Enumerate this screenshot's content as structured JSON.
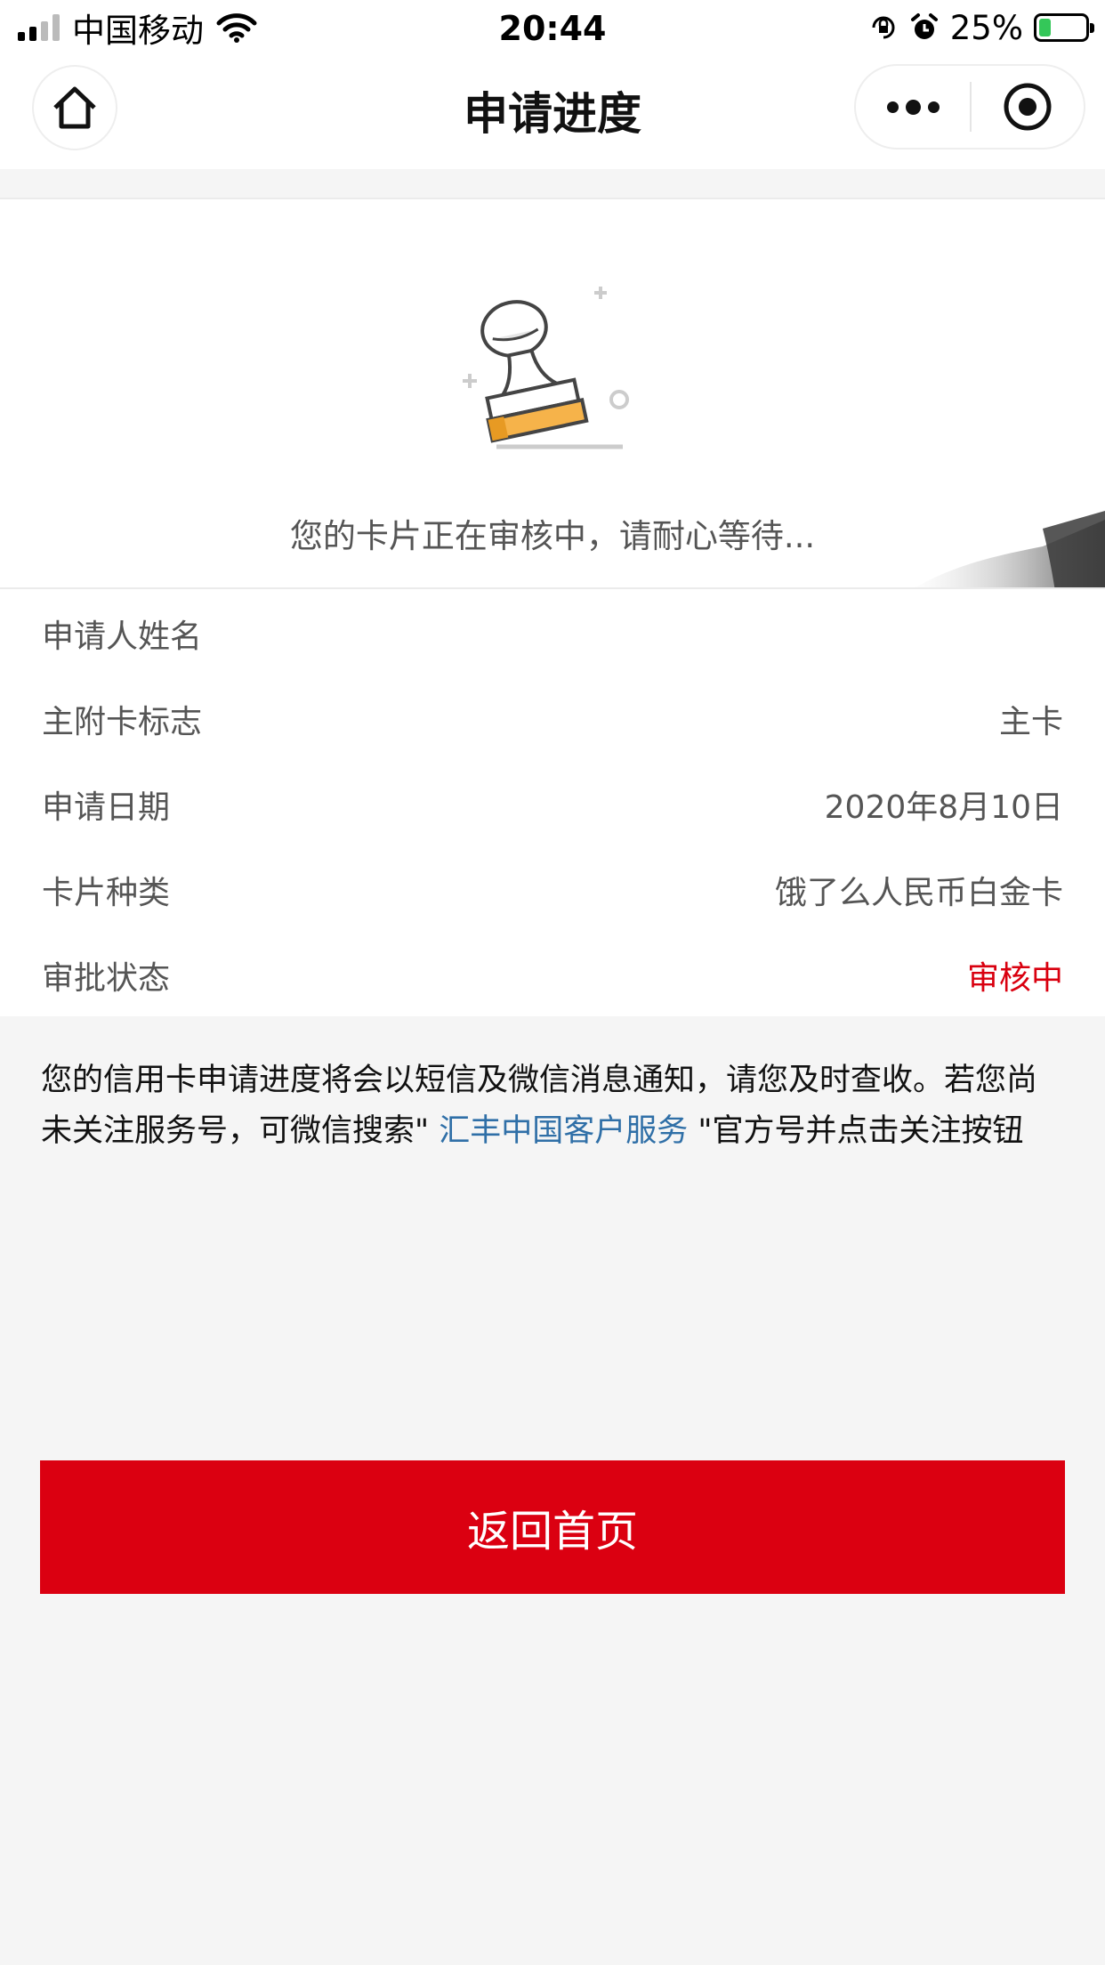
{
  "status_bar": {
    "carrier": "中国移动",
    "time": "20:44",
    "battery": "25%"
  },
  "nav": {
    "title": "申请进度"
  },
  "status_card": {
    "message": "您的卡片正在审核中，请耐心等待..."
  },
  "details": [
    {
      "label": "申请人姓名",
      "value": ""
    },
    {
      "label": "主附卡标志",
      "value": "主卡"
    },
    {
      "label": "申请日期",
      "value": "2020年8月10日"
    },
    {
      "label": "卡片种类",
      "value": "饿了么人民币白金卡"
    },
    {
      "label": "审批状态",
      "value": "审核中"
    }
  ],
  "note": {
    "before": "您的信用卡申请进度将会以短信及微信消息通知，请您及时查收。若您尚未关注服务号，可微信搜索\" ",
    "link": "汇丰中国客户服务",
    "after": " \"官方号并点击关注按钮"
  },
  "button": {
    "label": "返回首页"
  },
  "colors": {
    "accent_red": "#db0011",
    "link_blue": "#2f6fa7",
    "status_red": "#d9000f",
    "stamp_orange": "#f6b34a"
  }
}
